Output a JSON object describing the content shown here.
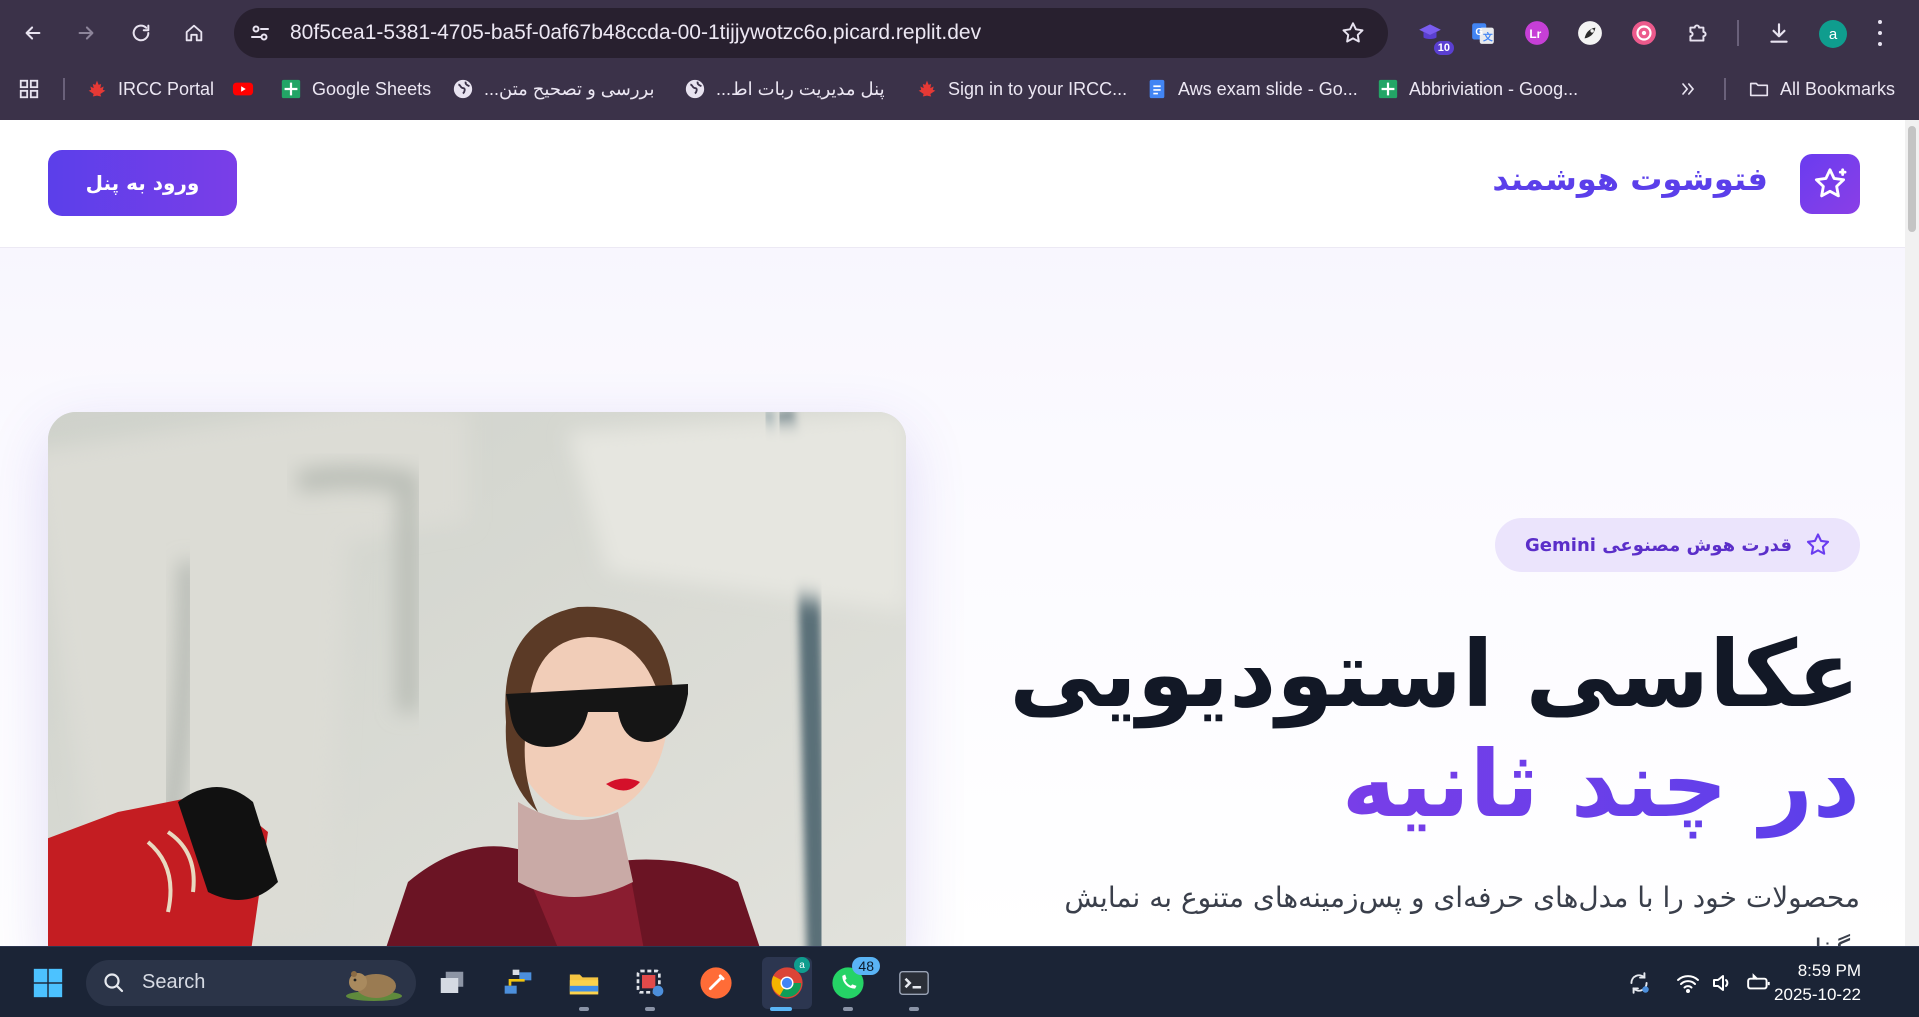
{
  "browser": {
    "url": "80f5cea1-5381-4705-ba5f-0af67b48ccda-00-1tijjywotzc6o.picard.replit.dev",
    "extension_badge": "10",
    "profile_initial": "a",
    "bookmarks": [
      {
        "label": "IRCC Portal",
        "icon": "maple-leaf-icon"
      },
      {
        "label": "",
        "icon": "youtube-icon"
      },
      {
        "label": "Google Sheets",
        "icon": "sheets-icon"
      },
      {
        "label": "بررسی و تصحیح متن...",
        "icon": "globe-icon"
      },
      {
        "label": "پنل مدیریت ربات اط...",
        "icon": "globe-icon"
      },
      {
        "label": "Sign in to your IRCC...",
        "icon": "maple-leaf-icon"
      },
      {
        "label": "Aws exam slide - Go...",
        "icon": "docs-icon"
      },
      {
        "label": "Abbriviation - Goog...",
        "icon": "sheets-icon"
      }
    ],
    "all_bookmarks": "All Bookmarks"
  },
  "site": {
    "brand_name": "فتوشوت هوشمند",
    "login_button": "ورود به پنل",
    "badge_text": "قدرت هوش مصنوعی Gemini",
    "headline_line1": "عکاسی استودیویی",
    "headline_line2": "در چند ثانیه",
    "subtext": "محصولات خود را با مدل‌های حرفه‌ای و پس‌زمینه‌های متنوع به نمایش بگذارید",
    "accent_color": "#5b3fea"
  },
  "taskbar": {
    "search_placeholder": "Search",
    "whatsapp_badge": "48",
    "chrome_badge": "a",
    "time": "8:59 PM",
    "date": "2025-10-22"
  }
}
